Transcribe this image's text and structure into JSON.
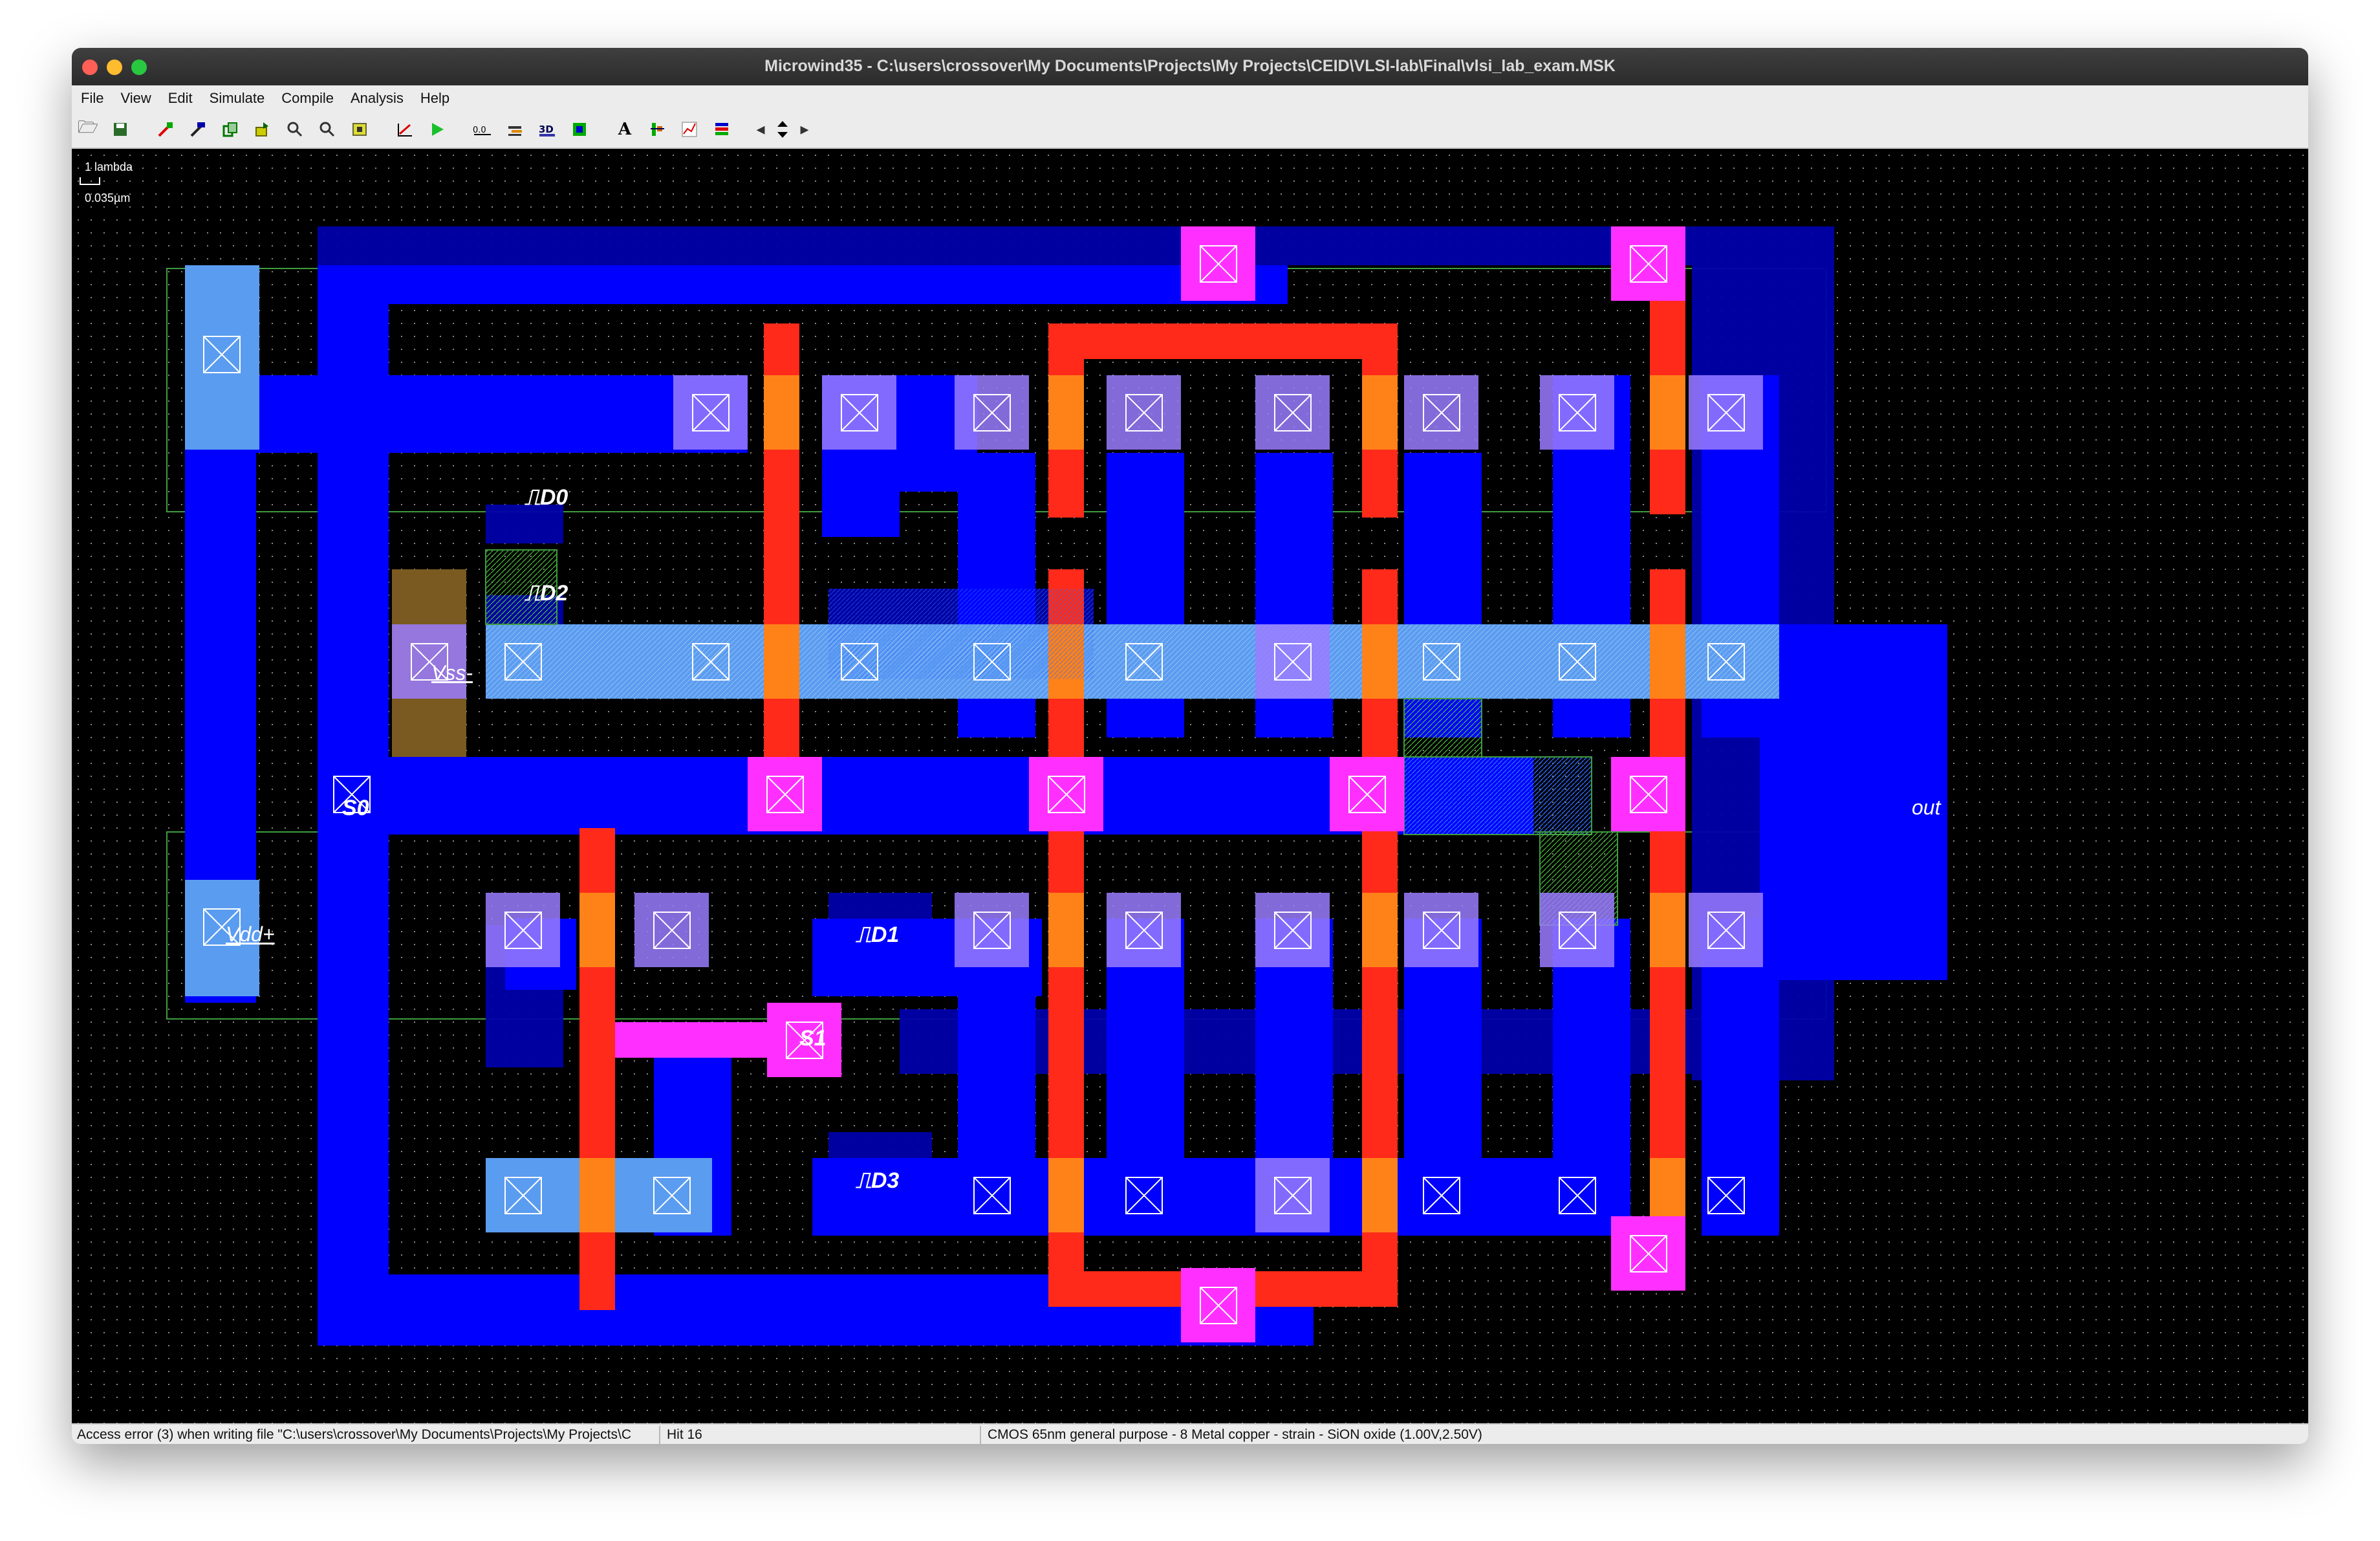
{
  "window": {
    "title": "Microwind35 - C:\\users\\crossover\\My Documents\\Projects\\My Projects\\CEID\\VLSI-lab\\Final\\vlsi_lab_exam.MSK"
  },
  "menu": [
    "File",
    "View",
    "Edit",
    "Simulate",
    "Compile",
    "Analysis",
    "Help"
  ],
  "toolbar": {
    "icons": [
      "open-icon",
      "save-icon",
      "draw-box-icon",
      "draw-line-icon",
      "duplicate-icon",
      "move-icon",
      "zoom-in-icon",
      "zoom-out-icon",
      "fit-icon",
      "measure-icon",
      "run-simulation-icon",
      "mos-generator-icon",
      "via-icon",
      "3d-icon",
      "connect-icon",
      "text-icon",
      "process-icon",
      "graph-icon",
      "layers-icon",
      "scroll-left-icon",
      "scroll-vertical-icon",
      "scroll-right-icon"
    ],
    "text_button": "A"
  },
  "scale": {
    "top": "1 lambda",
    "bottom": "0.035µm"
  },
  "layout_labels": {
    "d0": "D0",
    "d2": "D2",
    "vss": "Vss-",
    "s0": "S0",
    "vdd": "Vdd+",
    "d1": "D1",
    "s1": "S1",
    "d3": "D3",
    "out": "out"
  },
  "colors": {
    "metal1": "#0000ff",
    "metal2": "#3c3cff",
    "polysilicon": "#ff2a1a",
    "n_diffusion": "#5a9cf0",
    "contact_pad": "#ff30ff",
    "nwell_outline": "#40b040",
    "background": "#000000"
  },
  "status": {
    "message": "Access error (3) when writing file \"C:\\users\\crossover\\My Documents\\Projects\\My Projects\\C",
    "hit": "Hit 16",
    "process": "CMOS 65nm general purpose - 8 Metal copper - strain - SiON oxide (1.00V,2.50V)"
  }
}
